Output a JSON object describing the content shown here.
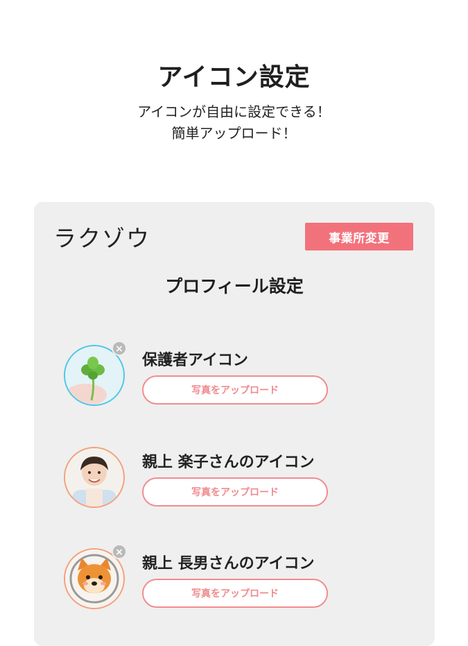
{
  "promo": {
    "title": "アイコン設定",
    "subtitle_line1": "アイコンが自由に設定できる！",
    "subtitle_line2": "簡単アップロード！"
  },
  "app": {
    "logo": "ラクゾウ",
    "office_change_button": "事業所変更",
    "section_title": "プロフィール設定",
    "accent_color": "#f2727c"
  },
  "icons": [
    {
      "label": "保護者アイコン",
      "upload_label": "写真をアップロード",
      "avatar": "clover-photo",
      "removable": true
    },
    {
      "label": "親上 楽子さんのアイコン",
      "upload_label": "写真をアップロード",
      "avatar": "person-photo",
      "removable": false
    },
    {
      "label": "親上 長男さんのアイコン",
      "upload_label": "写真をアップロード",
      "avatar": "shiba-dog-photo",
      "removable": true
    }
  ]
}
